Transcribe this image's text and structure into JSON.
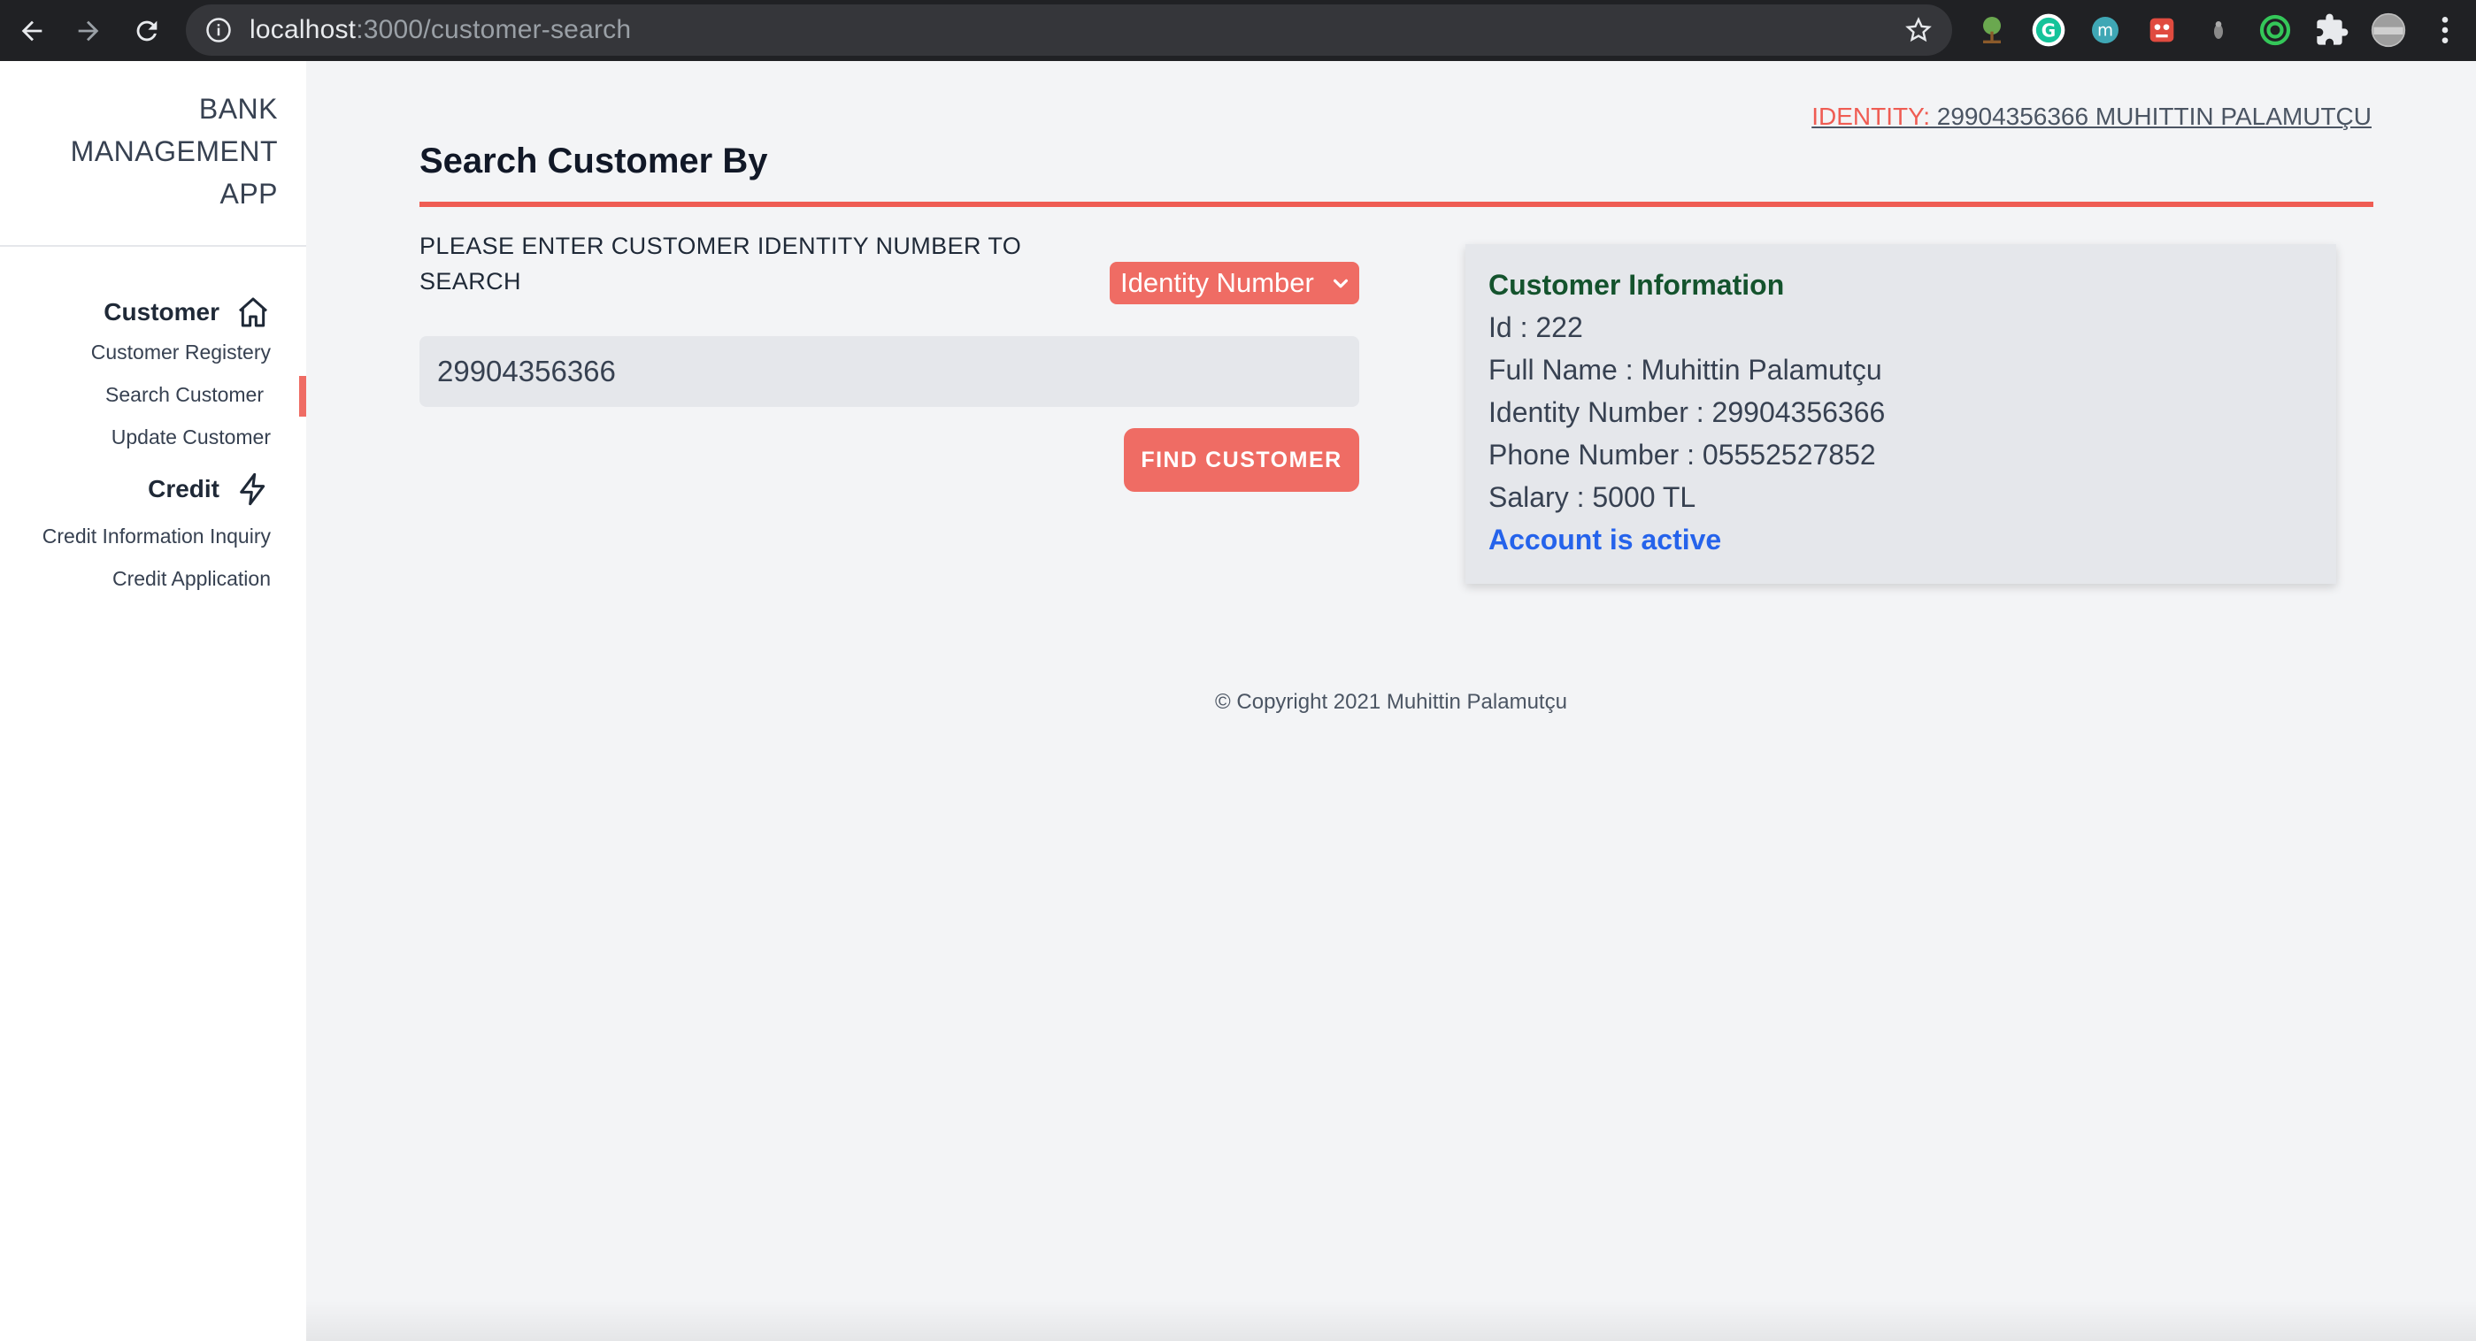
{
  "browser": {
    "url_host": "localhost",
    "url_path": ":3000/customer-search"
  },
  "sidebar": {
    "brand_lines": [
      "BANK",
      "MANAGEMENT",
      "APP"
    ],
    "sections": [
      {
        "title": "Customer",
        "icon": "home-icon",
        "items": [
          "Customer Registery",
          "Search Customer",
          "Update Customer"
        ]
      },
      {
        "title": "Credit",
        "icon": "lightning-icon",
        "items": [
          "Credit Information Inquiry",
          "Credit Application"
        ]
      }
    ],
    "active_item": "Search Customer"
  },
  "header": {
    "identity_label": "IDENTITY:",
    "identity_value": " 29904356366 MUHITTIN PALAMUTÇU"
  },
  "main": {
    "title": "Search Customer By",
    "prompt": "PLEASE ENTER CUSTOMER IDENTITY NUMBER TO SEARCH",
    "search_type": "Identity Number",
    "search_value": "29904356366",
    "find_button": "FIND CUSTOMER"
  },
  "customer_info": {
    "title": "Customer Information",
    "id": "Id : 222",
    "full_name": "Full Name : Muhittin Palamutçu",
    "identity_number": "Identity Number : 29904356366",
    "phone_number": "Phone Number : 05552527852",
    "salary": "Salary : 5000 TL",
    "status": "Account is active"
  },
  "footer": {
    "copyright": "© Copyright 2021 Muhittin Palamutçu"
  },
  "colors": {
    "accent": "#ef6c64",
    "card_title": "#14532d",
    "status": "#2563eb"
  }
}
